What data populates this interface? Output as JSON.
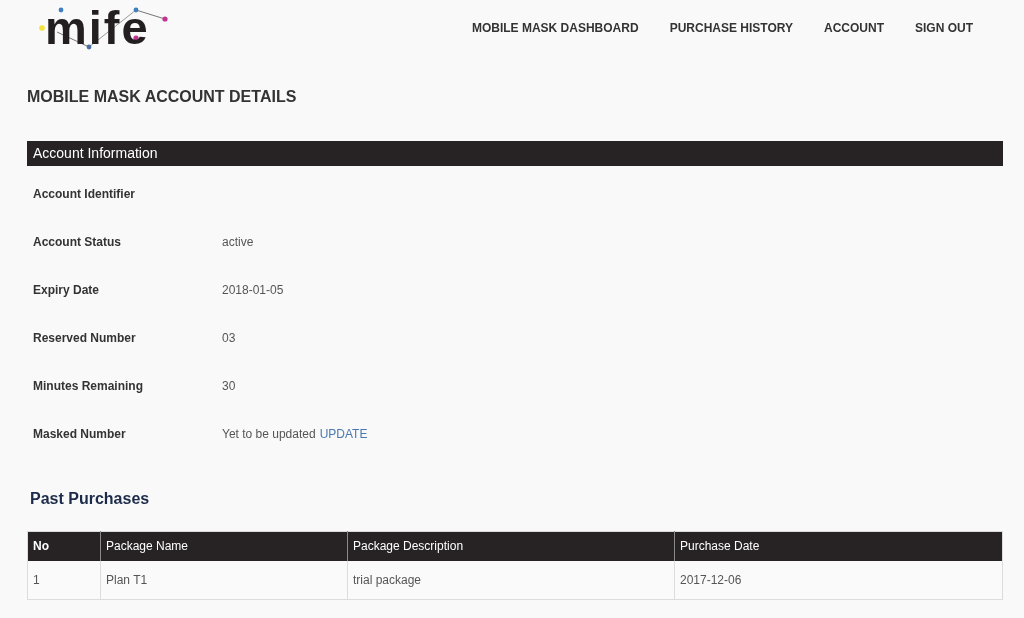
{
  "header": {
    "logo": "mife",
    "nav": [
      "MOBILE MASK DASHBOARD",
      "PURCHASE HISTORY",
      "ACCOUNT",
      "SIGN OUT"
    ]
  },
  "page_title": "MOBILE MASK ACCOUNT DETAILS",
  "account_information": {
    "heading": "Account Information",
    "fields": [
      {
        "label": "Account Identifier"
      },
      {
        "label": "Account Status",
        "value": "active"
      },
      {
        "label": "Expiry Date",
        "value": "2018-01-05"
      },
      {
        "label": "Reserved Number",
        "value": "03"
      },
      {
        "label": "Minutes Remaining",
        "value": "30"
      },
      {
        "label": "Masked Number",
        "value": "Yet to be updated",
        "link": "UPDATE"
      }
    ]
  },
  "past_purchases": {
    "heading": "Past Purchases",
    "table": {
      "columns": [
        "No",
        "Package Name",
        "Package Description",
        "Purchase Date"
      ],
      "rows": [
        [
          "1",
          "Plan T1",
          "trial package",
          "2017-12-06"
        ]
      ]
    }
  }
}
